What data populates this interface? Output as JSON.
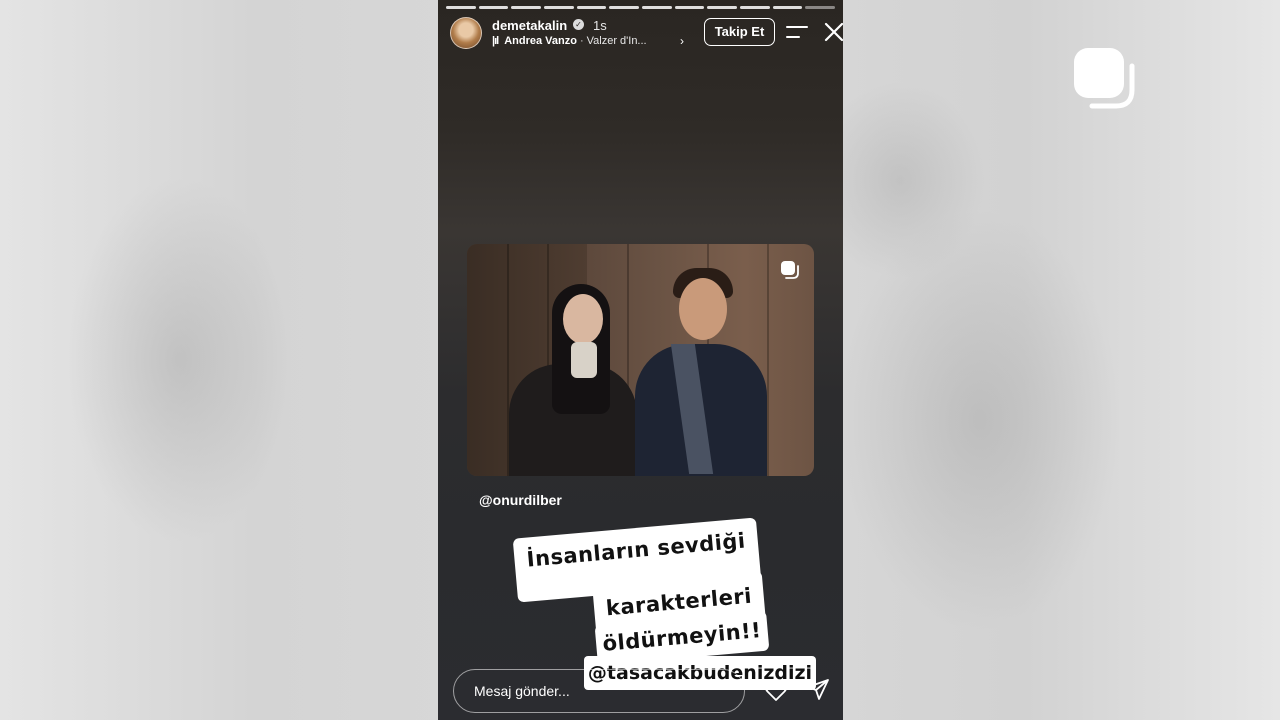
{
  "story": {
    "username": "demetakalin",
    "time": "1s",
    "music": {
      "artist": "Andrea Vanzo",
      "separator": "·",
      "song": "Valzer d'In..."
    },
    "follow_label": "Takip Et",
    "progress_segments": 12,
    "current_segment": 12
  },
  "post": {
    "mention": "@onurdilber"
  },
  "stickers": {
    "line1": "İnsanların sevdiği",
    "line2": "karakterleri",
    "line3": "öldürmeyin!!",
    "tag": "@tasacakbudenizdizi"
  },
  "reply": {
    "placeholder": "Mesaj gönder..."
  },
  "icons": {
    "menu": "menu-icon",
    "close": "close-icon",
    "copy": "copy-icon",
    "heart": "heart-icon",
    "send": "send-icon"
  }
}
